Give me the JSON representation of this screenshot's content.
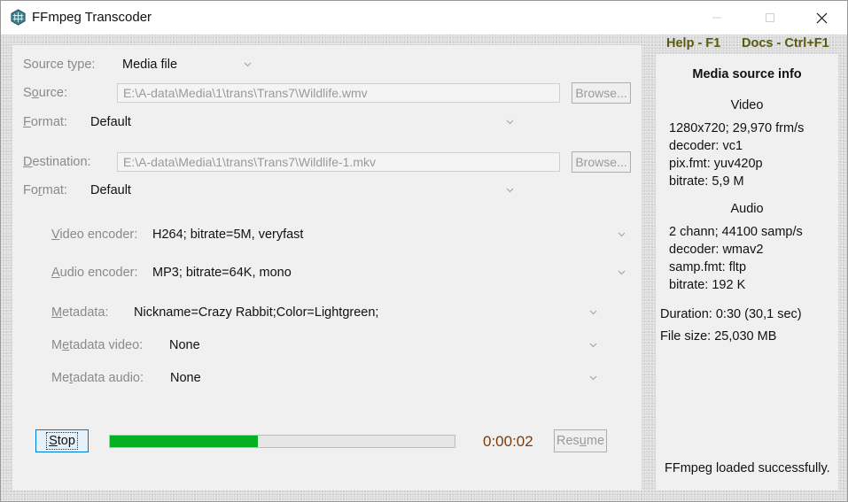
{
  "window": {
    "title": "FFmpeg Transcoder",
    "minimize_label": "—",
    "maximize_label": "☐",
    "close_label": "✕"
  },
  "icons": {
    "app": "ffmpeg-hex-icon",
    "dropdown": "chevron-down-icon"
  },
  "colors": {
    "progress_fill": "#06b025",
    "timer": "#7a3a0c",
    "help_links": "#5a5a12",
    "focus_border": "#0078d7"
  },
  "source_type": {
    "label_prefix": "Source type:",
    "value": "Media file"
  },
  "source": {
    "label_first": "S",
    "label_ul": "o",
    "label_rest": "urce:",
    "path": "E:\\A-data\\Media\\1\\trans\\Trans7\\Wildlife.wmv",
    "browse_label": "Browse..."
  },
  "source_format": {
    "label_ul": "F",
    "label_rest": "ormat:",
    "value": "Default"
  },
  "destination": {
    "label_ul": "D",
    "label_rest": "estination:",
    "path": "E:\\A-data\\Media\\1\\trans\\Trans7\\Wildlife-1.mkv",
    "browse_label": "Browse..."
  },
  "dest_format": {
    "label_first": "Fo",
    "label_ul": "r",
    "label_rest": "mat:",
    "value": "Default"
  },
  "video_encoder": {
    "label_ul": "V",
    "label_rest": "ideo encoder:",
    "value": "H264; bitrate=5M, veryfast"
  },
  "audio_encoder": {
    "label_ul": "A",
    "label_rest": "udio encoder:",
    "value": "MP3; bitrate=64K, mono"
  },
  "metadata": {
    "label_ul": "M",
    "label_rest": "etadata:",
    "value": "Nickname=Crazy Rabbit;Color=Lightgreen;"
  },
  "metadata_video": {
    "label_first": "M",
    "label_ul": "e",
    "label_rest": "tadata video:",
    "value": "None"
  },
  "metadata_audio": {
    "label_first": "Me",
    "label_ul": "t",
    "label_rest": "adata audio:",
    "value": "None"
  },
  "controls": {
    "stop_ul": "S",
    "stop_rest": "top",
    "progress_fraction": 0.43,
    "elapsed": "0:00:02",
    "resume_first": "Res",
    "resume_ul": "u",
    "resume_rest": "me"
  },
  "help": {
    "help_label": "Help - F1",
    "docs_label": "Docs - Ctrl+F1"
  },
  "info": {
    "title": "Media source info",
    "video_heading": "Video",
    "video_lines": [
      "1280x720; 29,970 frm/s",
      "decoder: vc1",
      "pix.fmt: yuv420p",
      "bitrate: 5,9 M"
    ],
    "audio_heading": "Audio",
    "audio_lines": [
      "2 chann; 44100 samp/s",
      "decoder: wmav2",
      "samp.fmt: fltp",
      "bitrate: 192 K"
    ],
    "duration": "Duration: 0:30 (30,1 sec)",
    "file_size": "File size: 25,030 MB",
    "status": "FFmpeg loaded successfully."
  }
}
